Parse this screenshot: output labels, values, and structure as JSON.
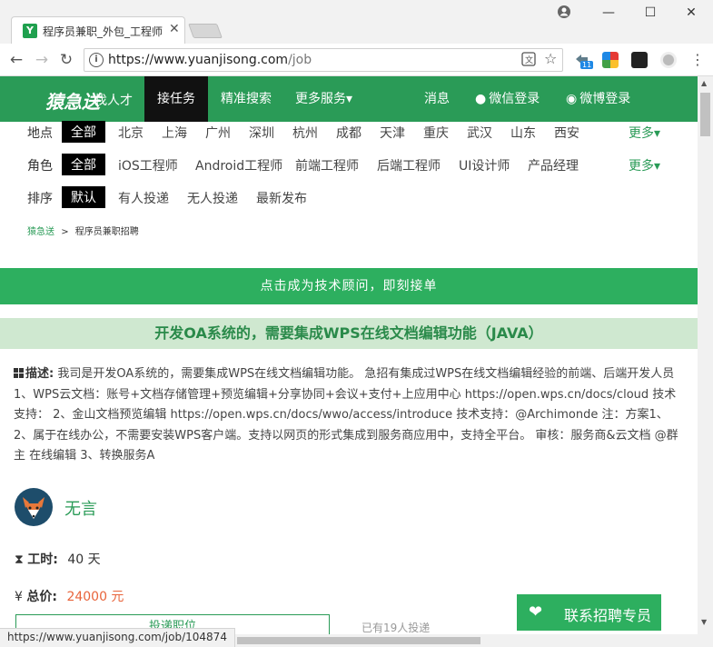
{
  "browser": {
    "tab_title": "程序员兼职_外包_工程师",
    "tab_favicon": "Y",
    "url_main": "https://www.yuanjisong.com",
    "url_path": "/job",
    "status_url": "https://www.yuanjisong.com/job/104874",
    "ext_badge": "11"
  },
  "header": {
    "logo": "猿急送",
    "logo_sub": "找人才",
    "nav": [
      "接任务",
      "精准搜索",
      "更多服务▾"
    ],
    "right": [
      "消息",
      "微信登录",
      "微博登录"
    ],
    "brand_color": "#2a9b57"
  },
  "filters": {
    "location": {
      "label": "地点",
      "options": [
        "全部",
        "北京",
        "上海",
        "广州",
        "深圳",
        "杭州",
        "成都",
        "天津",
        "重庆",
        "武汉",
        "山东",
        "西安"
      ],
      "more": "更多▾"
    },
    "role": {
      "label": "角色",
      "options": [
        "全部",
        "iOS工程师",
        "Android工程师",
        "前端工程师",
        "后端工程师",
        "UI设计师",
        "产品经理"
      ],
      "more": "更多▾"
    },
    "sort": {
      "label": "排序",
      "options": [
        "默认",
        "有人投递",
        "无人投递",
        "最新发布"
      ]
    }
  },
  "breadcrumb": {
    "home": "猿急送",
    "sep": ">",
    "current": "程序员兼职招聘"
  },
  "cta": "点击成为技术顾问，即刻接单",
  "job": {
    "title": "开发OA系统的，需要集成WPS在线文档编辑功能（JAVA）",
    "desc_label": "描述:",
    "desc_text": "我司是开发OA系统的，需要集成WPS在线文档编辑功能。 急招有集成过WPS在线文档编辑经验的前端、后端开发人员 1、WPS云文档：账号+文档存储管理+预览编辑+分享协同+会议+支付+上应用中心 https://open.wps.cn/docs/cloud 技术支持： 2、金山文档预览编辑 https://open.wps.cn/docs/wwo/access/introduce 技术支持：@Archimonde 注：方案1、2、属于在线办公，不需要安装WPS客户端。支持以网页的形式集成到服务商应用中，支持全平台。 审核：服务商&云文档 @群主 在线编辑 3、转换服务A",
    "author": "无言",
    "duration_label": "工时:",
    "duration": "40 天",
    "price_label": "总价:",
    "price": "24000 元",
    "apply": "投递职位",
    "applied": "已有19人投递",
    "price_color": "#e8643b"
  },
  "contact": "联系招聘专员"
}
